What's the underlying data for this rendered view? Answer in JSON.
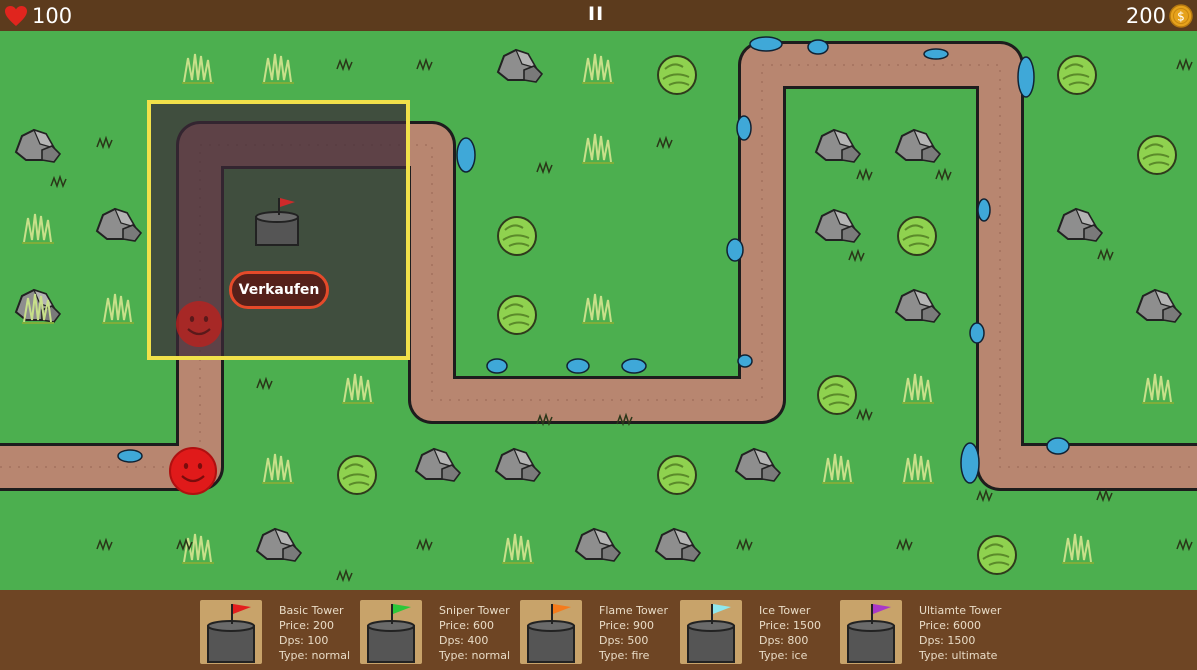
{
  "hud": {
    "lives": "100",
    "pause_label": "II",
    "money": "200",
    "colors": {
      "heart": "#e0251e",
      "coin": "#e6a21c"
    }
  },
  "map": {
    "grass_color": "#4caf4f",
    "path_color": "#b88670",
    "enemies": [
      {
        "name": "enemy-smiley",
        "color": "#e01a1a"
      },
      {
        "name": "enemy-smiley-behind-panel",
        "color": "#c0201c"
      }
    ]
  },
  "selected_tower": {
    "sell_label": "Verkaufen",
    "flag_color": "#cf2a2a"
  },
  "shop": {
    "towers": [
      {
        "name": "Basic Tower",
        "price": "Price: 200",
        "dps": "Dps: 100",
        "type": "Type: normal",
        "flag_color": "#e31e1e"
      },
      {
        "name": "Sniper Tower",
        "price": "Price: 600",
        "dps": "Dps: 400",
        "type": "Type: normal",
        "flag_color": "#2bc83a"
      },
      {
        "name": "Flame Tower",
        "price": "Price: 900",
        "dps": "Dps: 500",
        "type": "Type: fire",
        "flag_color": "#f57b1c"
      },
      {
        "name": "Ice Tower",
        "price": "Price: 1500",
        "dps": "Dps: 800",
        "type": "Type: ice",
        "flag_color": "#8fe8ee"
      },
      {
        "name": "Ultiamte Tower",
        "price": "Price: 6000",
        "dps": "Dps: 1500",
        "type": "Type: ultimate",
        "flag_color": "#a938c8"
      }
    ]
  }
}
